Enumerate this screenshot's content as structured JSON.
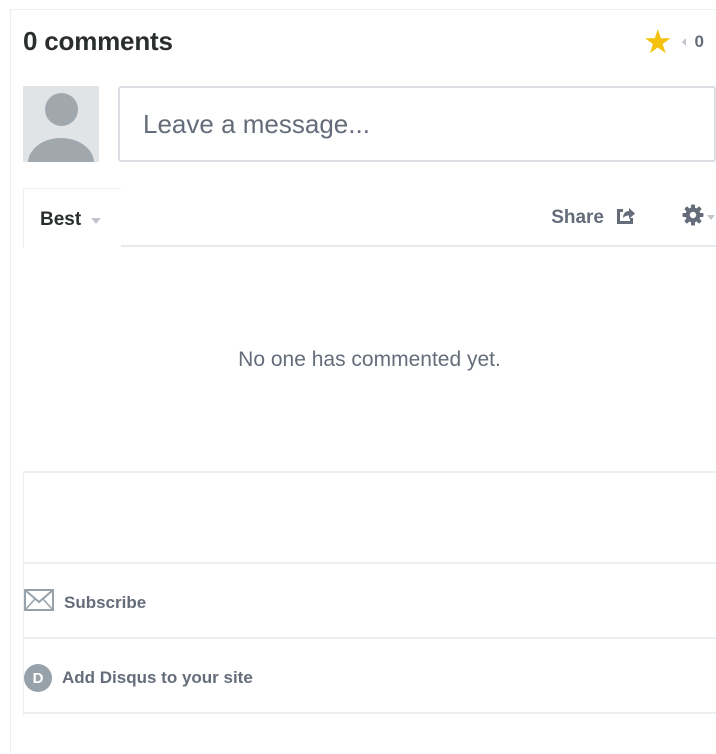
{
  "header": {
    "title": "0 comments",
    "recommend_count": "0",
    "star_icon": "★"
  },
  "composer": {
    "placeholder": "Leave a message..."
  },
  "nav": {
    "sort_label": "Best",
    "share_label": "Share"
  },
  "empty_state": "No one has commented yet.",
  "footer": {
    "subscribe_label": "Subscribe",
    "add_disqus_label": "Add Disqus to your site",
    "disqus_letter": "D"
  },
  "colors": {
    "star": "#f4c20d",
    "text_primary": "#2a2e2e",
    "text_muted": "#656c7a",
    "border": "#dbdfe4"
  },
  "icons": [
    "star-icon",
    "share-icon",
    "gear-icon",
    "envelope-icon",
    "disqus-icon",
    "chevron-down-icon"
  ]
}
